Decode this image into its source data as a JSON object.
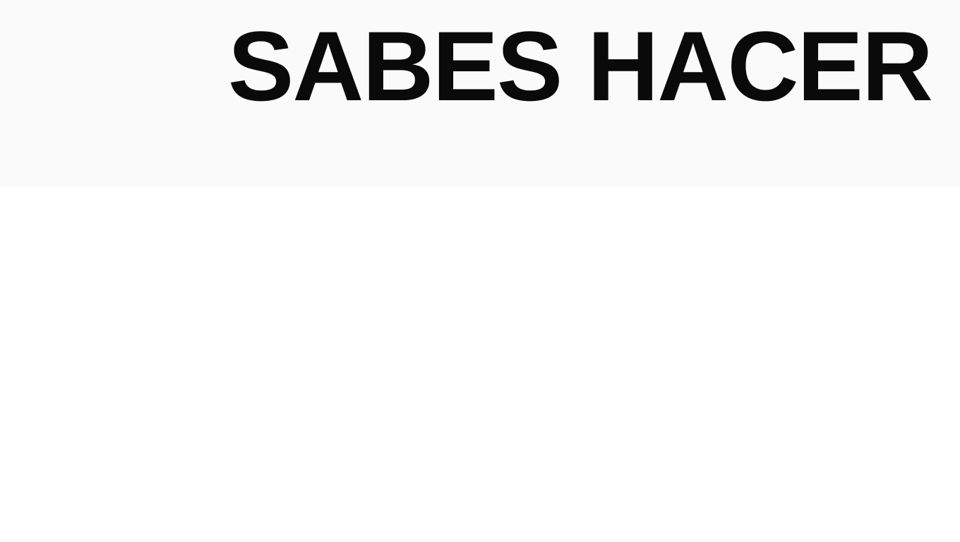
{
  "header": {
    "headline": "SABES HACER"
  },
  "colors": {
    "header_background": "#fafafa",
    "page_background": "#ffffff",
    "headline_text": "#0a0a0a"
  }
}
